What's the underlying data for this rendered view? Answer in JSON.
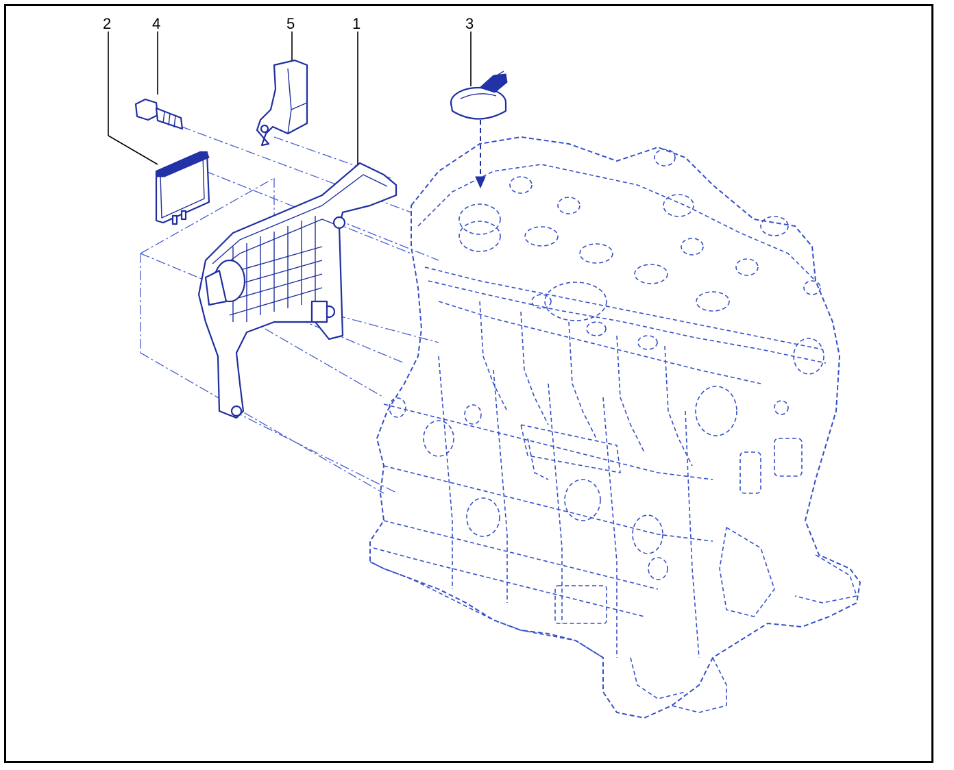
{
  "callouts": [
    {
      "id": "c2",
      "label": "2"
    },
    {
      "id": "c4",
      "label": "4"
    },
    {
      "id": "c5",
      "label": "5"
    },
    {
      "id": "c1",
      "label": "1"
    },
    {
      "id": "c3",
      "label": "3"
    }
  ],
  "colors": {
    "line_art": "#1f2fa0",
    "engine_dashed": "#3550c8",
    "frame": "#000000",
    "background": "#ffffff"
  }
}
